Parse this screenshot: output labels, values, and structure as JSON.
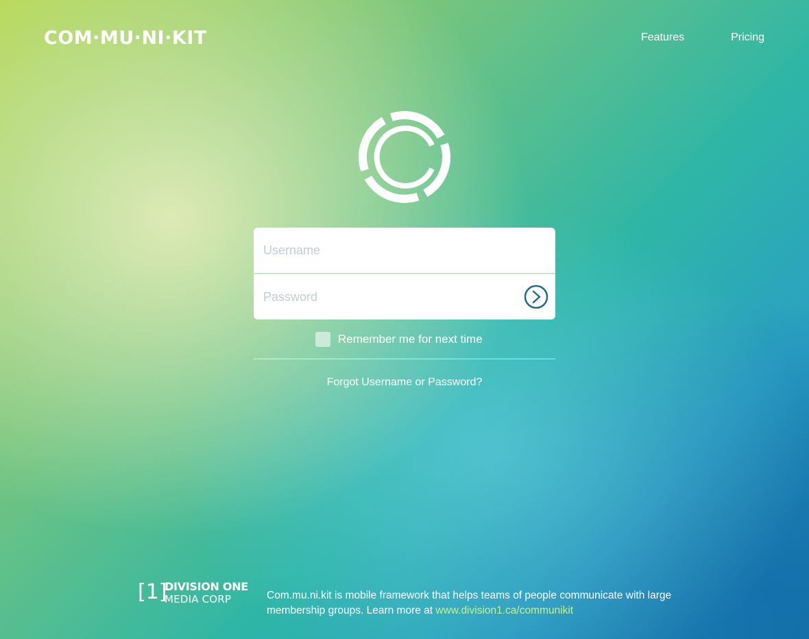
{
  "header": {
    "logo": "COM·MU·NI·KIT",
    "nav": [
      {
        "label": "Features"
      },
      {
        "label": "Pricing"
      }
    ]
  },
  "brand_mark": {
    "icon": "communikit-c-logo-icon"
  },
  "login": {
    "username_placeholder": "Username",
    "password_placeholder": "Password",
    "submit_icon": "arrow-right-circle-icon",
    "remember_label": "Remember me for next time",
    "remember_checked": false,
    "forgot_label": "Forgot Username or Password?"
  },
  "footer": {
    "logo_bracket": "[1]",
    "logo_line1": "DIVISION ONE",
    "logo_line2": "MEDIA CORP",
    "description": "Com.mu.ni.kit is mobile framework that helps teams of people communicate with large membership groups. Learn more at ",
    "link_text": "www.division1.ca/communikit"
  },
  "colors": {
    "link_green": "#c6f28a",
    "submit_icon": "#1f6b8e",
    "text": "#ffffff"
  }
}
